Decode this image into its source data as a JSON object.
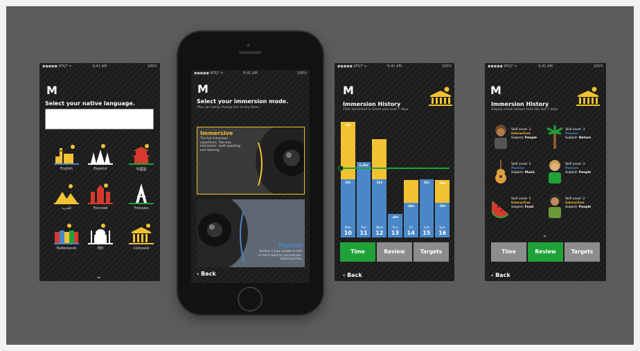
{
  "colors": {
    "yellow": "#f2c232",
    "blue": "#4b87c8",
    "green": "#1fa339",
    "gray_tab": "#8d8d8d"
  },
  "status": {
    "carrier": "●●●●● AT&T ᯤ",
    "time": "9:41 AM",
    "battery": "100%"
  },
  "logo": "M",
  "screen1": {
    "title": "Select your native language.",
    "input_value": "",
    "languages": [
      "English",
      "Español",
      "中國語",
      "العربية",
      "Русский",
      "Français",
      "Nederlands",
      "हिंदी",
      "ελληνικά"
    ],
    "scroll_icon": "chevron-down-icon"
  },
  "screen2": {
    "title": "Select your immersion mode.",
    "subtitle": "(You can easily change this at any time.)",
    "modes": [
      {
        "name": "Immersive",
        "description": "The full immersion experience. Two-way interaction - both speaking and listening."
      },
      {
        "name": "Passive",
        "description": "Perfect if your unable to talk or don't want to concentrate. Listening Only."
      }
    ],
    "back": "‹ Back"
  },
  "screen3": {
    "title": "Immersion History",
    "subtitle": "Time immersed in Greek over past 7 days.",
    "chart_data": {
      "type": "bar",
      "stacked": true,
      "categories": [
        "Mon 10",
        "Tue 11",
        "Wed 12",
        "Thu 13",
        "Fri 14",
        "Sat 15",
        "Sun 16"
      ],
      "days": [
        {
          "name": "Mon",
          "date": "10"
        },
        {
          "name": "Tue",
          "date": "11"
        },
        {
          "name": "Wed",
          "date": "12"
        },
        {
          "name": "Thu",
          "date": "13"
        },
        {
          "name": "Fri",
          "date": "14"
        },
        {
          "name": "Sat",
          "date": "15"
        },
        {
          "name": "Sun",
          "date": "16"
        }
      ],
      "series": [
        {
          "values": [
            1,
            1.3,
            1,
            0.4,
            0.6,
            1,
            0.6
          ],
          "labels": [
            "1hr",
            "1.3hr",
            "1hr",
            ".4hr",
            ".6hr",
            "1hr",
            ".6hr"
          ]
        },
        {
          "values": [
            1,
            0,
            0.7,
            0,
            0.4,
            0,
            0.4
          ],
          "labels": [
            "1hr",
            "",
            "",
            "",
            "",
            "",
            ".4hr"
          ]
        }
      ],
      "ylim": [
        0,
        2
      ]
    },
    "tabs": [
      "Time",
      "Review",
      "Targets"
    ],
    "active_tab": "Time",
    "back": "‹ Back"
  },
  "screen4": {
    "title": "Immersion History",
    "subtitle": "Display Greek lessons from the last 7 days.",
    "lessons": [
      {
        "level": "Skill Level: 3",
        "mode": "Interactive",
        "subject_label": "Subject:",
        "subject": "People"
      },
      {
        "level": "Skill Level: 3",
        "mode": "Passive",
        "subject_label": "Subject:",
        "subject": "Nature"
      },
      {
        "level": "Skill Level: 3",
        "mode": "Passive",
        "subject_label": "Subject:",
        "subject": "Music"
      },
      {
        "level": "Skill Level: 3",
        "mode": "Passive",
        "subject_label": "Subject:",
        "subject": "People"
      },
      {
        "level": "Skill Level: 3",
        "mode": "Interactive",
        "subject_label": "Subject:",
        "subject": "Food"
      },
      {
        "level": "Skill Level: 2",
        "mode": "Interactive",
        "subject_label": "Subject:",
        "subject": "People"
      }
    ],
    "tabs": [
      "Time",
      "Review",
      "Targets"
    ],
    "active_tab": "Review",
    "back": "‹ Back"
  }
}
